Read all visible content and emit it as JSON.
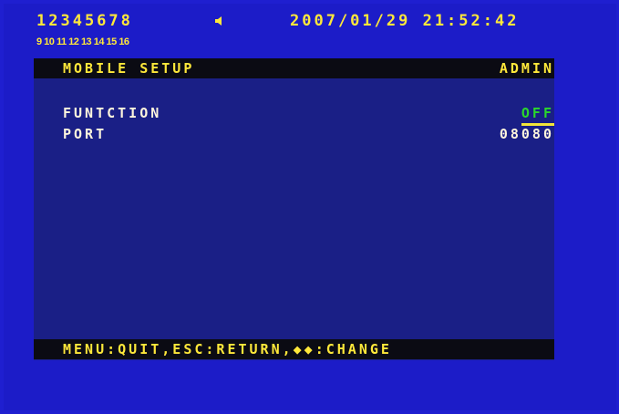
{
  "status": {
    "channels_top": "12345678",
    "channels_bottom": "9 10 11 12 13 14 15 16",
    "speaker_icon": "speaker-icon",
    "datetime": "2007/01/29 21:52:42"
  },
  "menu": {
    "title": "MOBILE SETUP",
    "user": "ADMIN",
    "settings": [
      {
        "label": "FUNTCTION",
        "value": "OFF"
      },
      {
        "label": "PORT",
        "value": "08080"
      }
    ],
    "footer_hint": "MENU:QUIT,ESC:RETURN,◆◆:CHANGE"
  },
  "colors": {
    "background": "#1f1fd0",
    "panel": "#1a1f86",
    "header_bar": "#0b0b13",
    "header_text": "#ffe83a",
    "value_selected": "#2bd82b",
    "underline": "#f2e43a"
  }
}
